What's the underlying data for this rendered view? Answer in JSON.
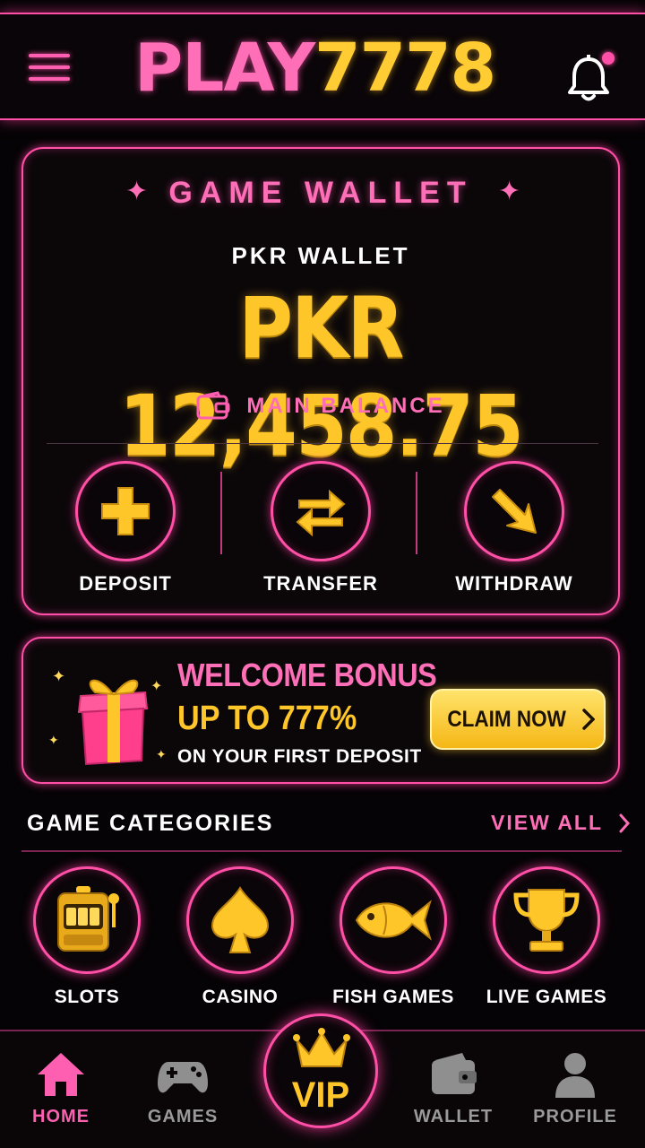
{
  "header": {
    "logo_part1": "PLAY",
    "logo_part2": "7778",
    "menu_icon": "hamburger-menu-icon",
    "notification_icon": "bell-icon"
  },
  "wallet": {
    "title": "GAME WALLET",
    "subtitle": "PKR WALLET",
    "amount": "PKR 12,458.75",
    "balance_label": "MAIN BALANCE",
    "actions": [
      {
        "label": "DEPOSIT",
        "icon": "plus-icon"
      },
      {
        "label": "TRANSFER",
        "icon": "transfer-arrows-icon"
      },
      {
        "label": "WITHDRAW",
        "icon": "arrow-down-right-icon"
      }
    ]
  },
  "bonus": {
    "line1": "WELCOME BONUS",
    "line2": "UP TO 777%",
    "line3": "ON YOUR FIRST DEPOSIT",
    "cta": "CLAIM NOW",
    "icon": "gift-box-icon"
  },
  "categories": {
    "title": "GAME CATEGORIES",
    "view_all": "VIEW ALL",
    "items": [
      {
        "label": "SLOTS",
        "icon": "slot-machine-icon"
      },
      {
        "label": "CASINO",
        "icon": "spade-icon"
      },
      {
        "label": "FISH GAMES",
        "icon": "fish-icon"
      },
      {
        "label": "LIVE GAMES",
        "icon": "trophy-icon"
      }
    ]
  },
  "bottom_nav": {
    "items": [
      {
        "label": "HOME",
        "icon": "home-icon",
        "active": true
      },
      {
        "label": "GAMES",
        "icon": "gamepad-icon",
        "active": false
      },
      {
        "label": "VIP",
        "icon": "crown-icon",
        "active": false
      },
      {
        "label": "WALLET",
        "icon": "wallet-icon",
        "active": false
      },
      {
        "label": "PROFILE",
        "icon": "user-icon",
        "active": false
      }
    ]
  },
  "colors": {
    "accent_pink": "#ff4fa6",
    "gold": "#ffc629",
    "background": "#050305"
  }
}
